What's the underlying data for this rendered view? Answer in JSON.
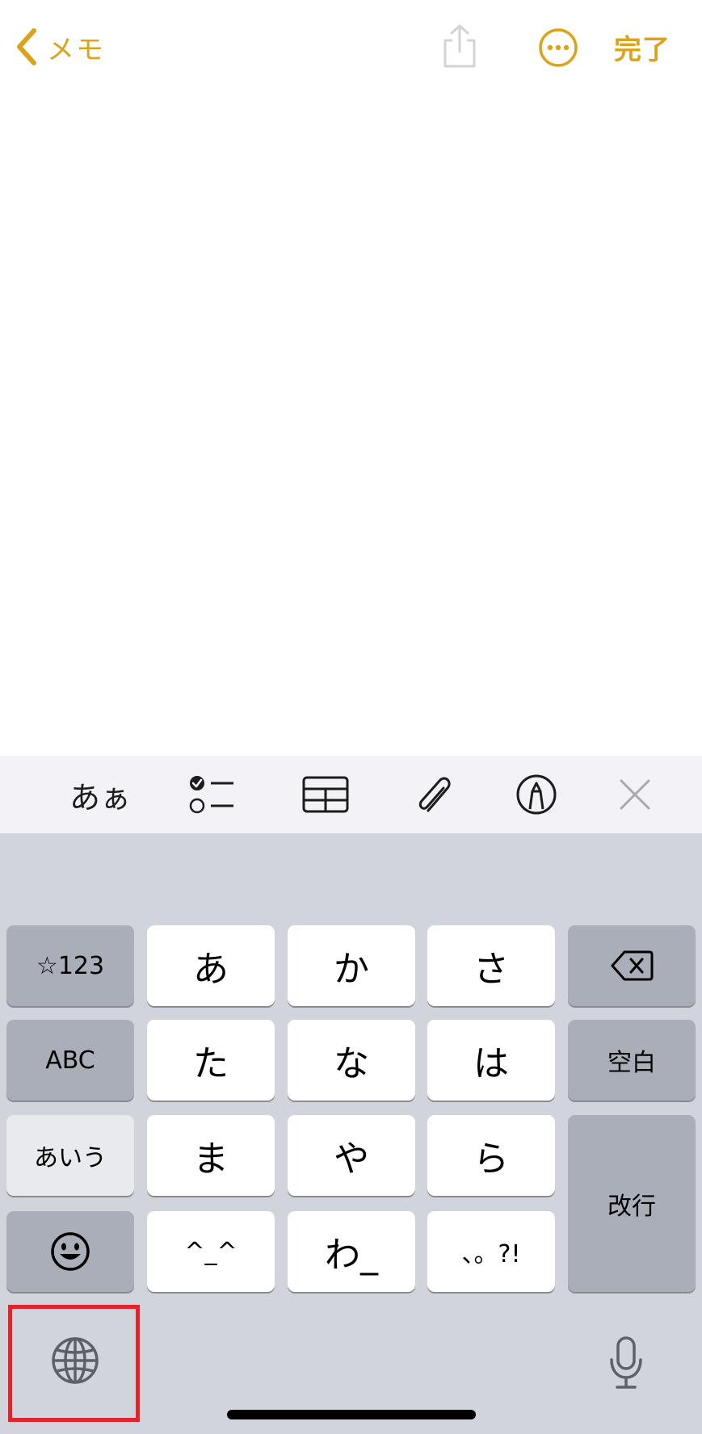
{
  "nav": {
    "back_label": "メモ",
    "done_label": "完了"
  },
  "toolbar": {
    "format_label": "あぁ"
  },
  "keyboard": {
    "rows": [
      [
        "☆123",
        "あ",
        "か",
        "さ",
        "delete"
      ],
      [
        "ABC",
        "た",
        "な",
        "は",
        "空白"
      ],
      [
        "あいう",
        "ま",
        "や",
        "ら",
        "改行"
      ],
      [
        "emoji",
        "^_^",
        "わ_",
        "、。?!"
      ]
    ],
    "numbers_key": "☆123",
    "abc_key": "ABC",
    "kana_key": "あいう",
    "space_key": "空白",
    "return_key": "改行",
    "kana": {
      "a": "あ",
      "ka": "か",
      "sa": "さ",
      "ta": "た",
      "na": "な",
      "ha": "は",
      "ma": "ま",
      "ya": "や",
      "ra": "ら",
      "kaomoji": "^_^",
      "wa": "わ_",
      "punct": "、。?!"
    }
  },
  "colors": {
    "accent": "#D9A41C",
    "highlight": "#E2232A",
    "keyboard_bg": "#D1D4DB",
    "key_dark": "#AAAEB8",
    "toolbar_bg": "#F2F2F7"
  }
}
